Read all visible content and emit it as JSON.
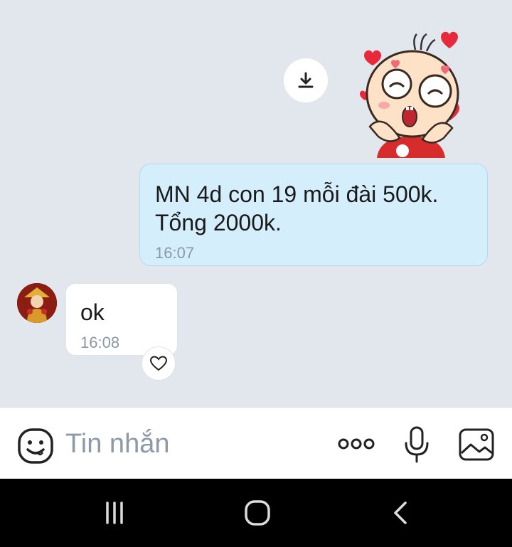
{
  "colors": {
    "chat_background": "#e2e6ed",
    "outgoing_bubble": "#d5eefc",
    "incoming_bubble": "#ffffff",
    "timestamp": "#8a98a8",
    "navbar": "#000000"
  },
  "messages": {
    "outgoing": {
      "text": "MN 4d con 19 mỗi đài 500k.\nTổng 2000k.",
      "time": "16:07"
    },
    "incoming": {
      "text": "ok",
      "time": "16:08"
    }
  },
  "icons": {
    "download": "download-icon",
    "sticker": "baby-hearts-sticker",
    "reaction": "heart-icon",
    "emoji": "emoji-icon",
    "more": "more-dots-icon",
    "mic": "microphone-icon",
    "image": "image-icon",
    "nav_recents": "recents-icon",
    "nav_home": "home-icon",
    "nav_back": "back-icon"
  },
  "composer": {
    "placeholder": "Tin nhắn"
  }
}
